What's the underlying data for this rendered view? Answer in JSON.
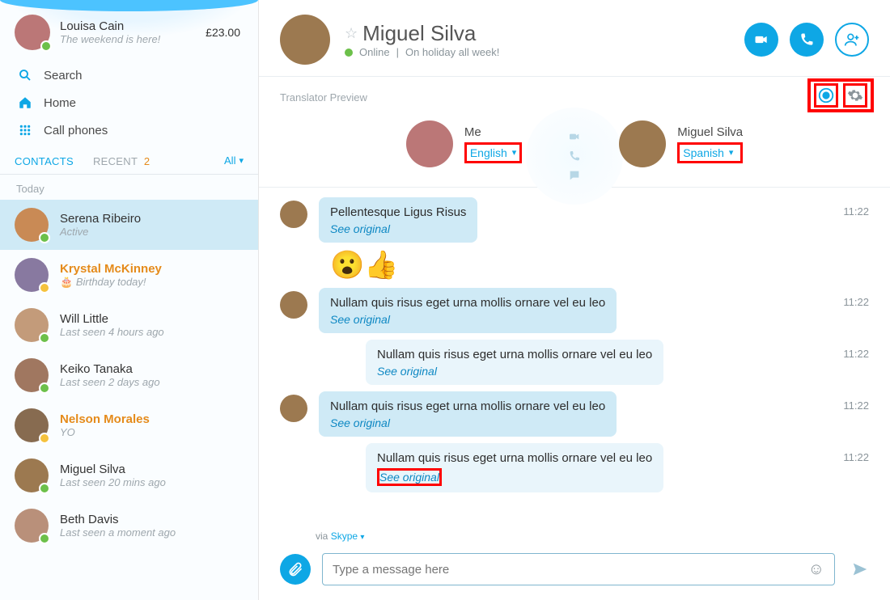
{
  "profile": {
    "name": "Louisa Cain",
    "mood": "The weekend is here!",
    "credit": "£23.00"
  },
  "nav": {
    "search": "Search",
    "home": "Home",
    "call_phones": "Call phones"
  },
  "tabs": {
    "contacts": "CONTACTS",
    "recent": "RECENT",
    "recent_count": "2",
    "all": "All"
  },
  "section": "Today",
  "contacts": [
    {
      "name": "Serena Ribeiro",
      "sub": "Active",
      "status": "online",
      "selected": true
    },
    {
      "name": "Krystal McKinney",
      "sub": "Birthday today!",
      "status": "away",
      "highlight": true,
      "birthday": true
    },
    {
      "name": "Will Little",
      "sub": "Last seen 4 hours ago",
      "status": "online"
    },
    {
      "name": "Keiko Tanaka",
      "sub": "Last seen 2 days ago",
      "status": "online"
    },
    {
      "name": "Nelson Morales",
      "sub": "YO",
      "status": "away",
      "highlight": true
    },
    {
      "name": "Miguel Silva",
      "sub": "Last seen 20 mins ago",
      "status": "online"
    },
    {
      "name": "Beth Davis",
      "sub": "Last seen a moment ago",
      "status": "online"
    }
  ],
  "chat": {
    "contact_name": "Miguel Silva",
    "status_text": "Online",
    "mood": "On holiday all week!",
    "translator_label": "Translator Preview",
    "me_label": "Me",
    "me_lang": "English",
    "them_label": "Miguel Silva",
    "them_lang": "Spanish"
  },
  "messages": [
    {
      "kind": "them",
      "text": "Pellentesque Ligus Risus",
      "see": "See original",
      "time": "11:22"
    },
    {
      "kind": "emoji"
    },
    {
      "kind": "them",
      "text": "Nullam quis risus eget urna mollis ornare vel eu leo",
      "see": "See original",
      "time": "11:22"
    },
    {
      "kind": "cont",
      "text": "Nullam quis risus eget urna mollis ornare vel eu leo",
      "see": "See original",
      "time": "11:22"
    },
    {
      "kind": "them",
      "text": "Nullam quis risus eget urna mollis ornare vel eu leo",
      "see": "See original",
      "time": "11:22"
    },
    {
      "kind": "cont",
      "text": "Nullam quis risus eget urna mollis ornare vel eu leo",
      "see": "See original",
      "time": "11:22",
      "red": true
    }
  ],
  "composer": {
    "via_prefix": "via ",
    "via_link": "Skype",
    "placeholder": "Type a message here"
  },
  "avatar_colors": {
    "louisa": "#b77",
    "serena": "#c98a55",
    "krystal": "#8879a0",
    "will": "#c39b7a",
    "keiko": "#a07760",
    "nelson": "#876b50",
    "miguel": "#9c7950",
    "beth": "#b9907a"
  }
}
